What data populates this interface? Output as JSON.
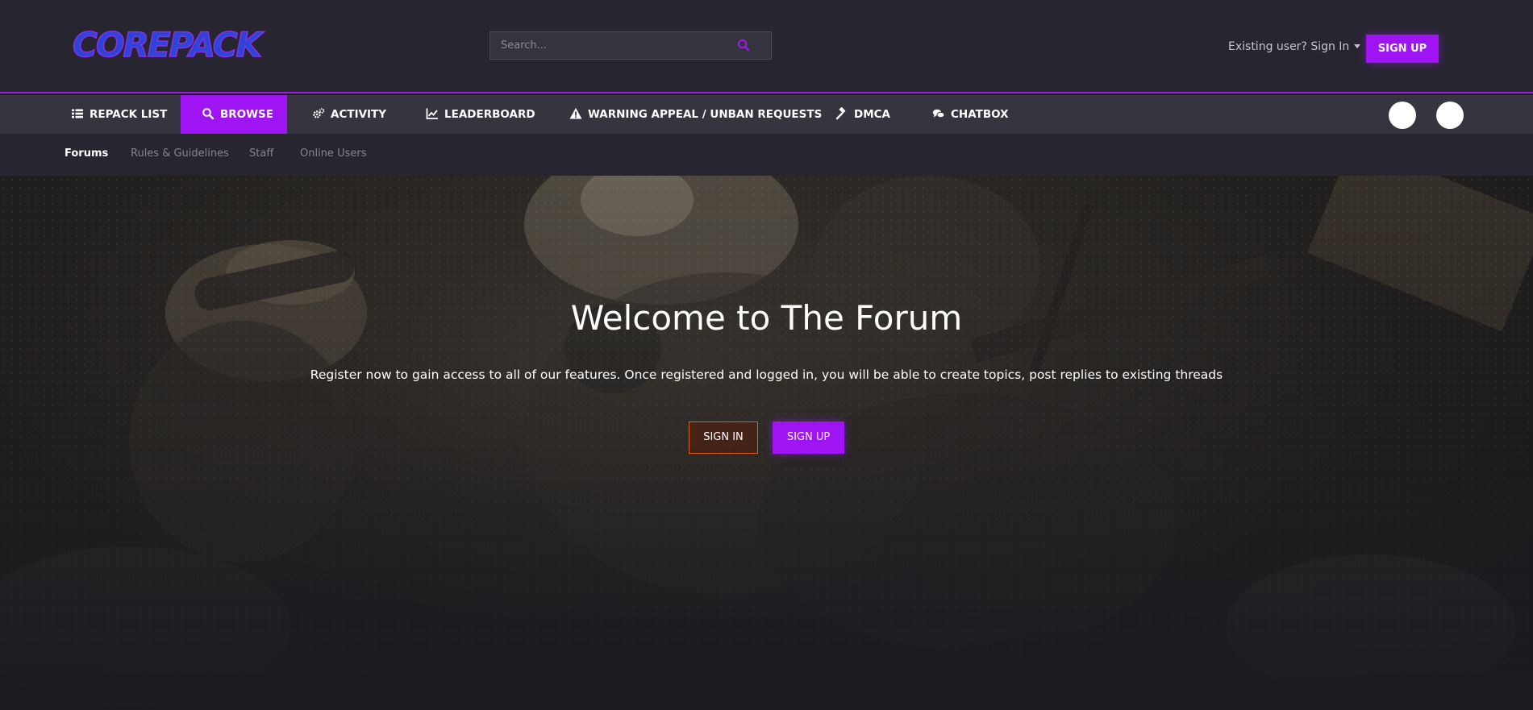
{
  "brand": {
    "logo_text": "COREPACK",
    "accent": "#9f14f2",
    "logo_fill": "#2b45d6"
  },
  "header": {
    "search": {
      "placeholder": "Search...",
      "value": ""
    },
    "existing_user": "Existing user? Sign In",
    "signup_label": "SIGN UP"
  },
  "nav": {
    "items": [
      {
        "label": "REPACK LIST",
        "icon": "list-icon"
      },
      {
        "label": "BROWSE",
        "icon": "search-icon",
        "active": true
      },
      {
        "label": "ACTIVITY",
        "icon": "cogs-icon"
      },
      {
        "label": "LEADERBOARD",
        "icon": "line-chart-icon"
      },
      {
        "label": "WARNING APPEAL / UNBAN REQUESTS",
        "icon": "warning-icon"
      },
      {
        "label": "DMCA",
        "icon": "gavel-icon"
      },
      {
        "label": "CHATBOX",
        "icon": "comments-icon"
      }
    ]
  },
  "subnav": {
    "items": [
      {
        "label": "Forums",
        "current": true
      },
      {
        "label": "Rules & Guidelines"
      },
      {
        "label": "Staff"
      },
      {
        "label": "Online Users"
      }
    ]
  },
  "hero": {
    "title": "Welcome to The Forum",
    "text": "Register now to gain access to all of our features. Once registered and logged in, you will be able to create topics, post replies to existing threads",
    "signin_label": "SIGN IN",
    "signup_label": "SIGN UP"
  }
}
